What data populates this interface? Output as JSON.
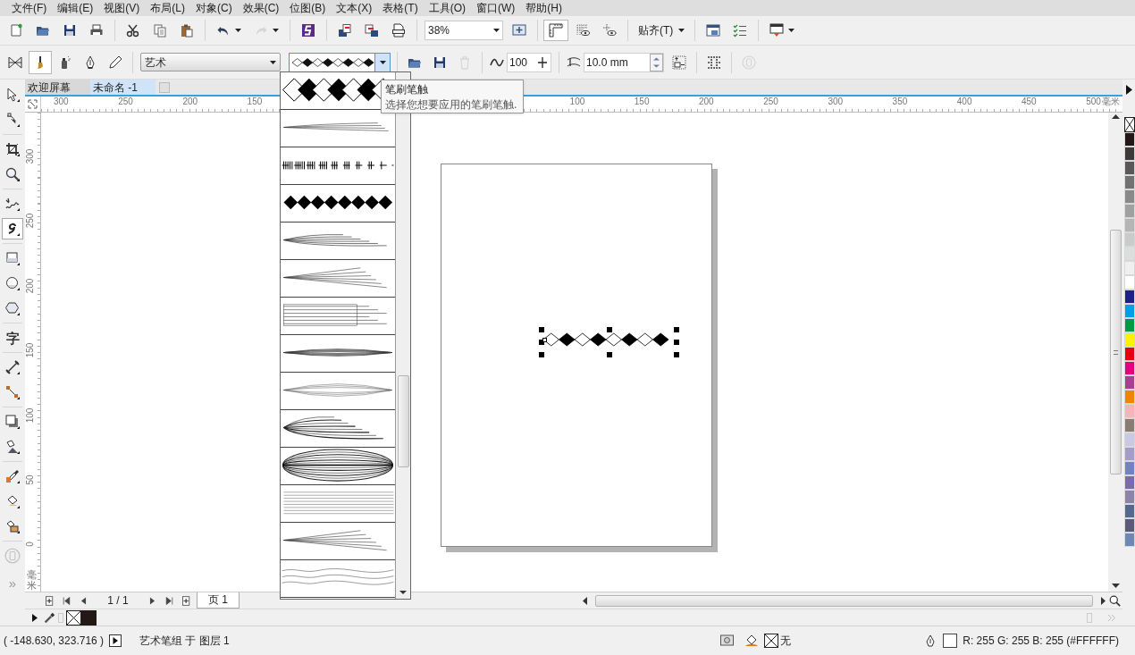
{
  "menu": [
    "文件(F)",
    "编辑(E)",
    "视图(V)",
    "布局(L)",
    "对象(C)",
    "效果(C)",
    "位图(B)",
    "文本(X)",
    "表格(T)",
    "工具(O)",
    "窗口(W)",
    "帮助(H)"
  ],
  "standard_toolbar": {
    "items": [
      {
        "kind": "new"
      },
      {
        "kind": "open"
      },
      {
        "kind": "save"
      },
      {
        "kind": "print"
      },
      {
        "kind": "separator"
      },
      {
        "kind": "cut"
      },
      {
        "kind": "copy"
      },
      {
        "kind": "paste"
      },
      {
        "kind": "separator"
      },
      {
        "kind": "undo",
        "caret": true
      },
      {
        "kind": "redo",
        "caret": true,
        "disabled": true
      },
      {
        "kind": "separator"
      },
      {
        "kind": "launcher"
      },
      {
        "kind": "separator"
      },
      {
        "kind": "import"
      },
      {
        "kind": "export"
      },
      {
        "kind": "pdf"
      },
      {
        "kind": "separator"
      },
      {
        "kind": "zoom-combo",
        "value": "38%"
      },
      {
        "kind": "fit"
      },
      {
        "kind": "separator"
      },
      {
        "kind": "rulers",
        "selected": true
      },
      {
        "kind": "grid",
        "selected": false
      },
      {
        "kind": "guidelines",
        "selected": false
      },
      {
        "kind": "separator"
      },
      {
        "kind": "text-menu",
        "label": "贴齐(T)"
      },
      {
        "kind": "separator"
      },
      {
        "kind": "options"
      },
      {
        "kind": "checklist"
      },
      {
        "kind": "separator"
      },
      {
        "kind": "welcome",
        "caret": true
      }
    ]
  },
  "property_bar": {
    "items": [
      {
        "kind": "preset-mode",
        "selected": false
      },
      {
        "kind": "brush-mode",
        "selected": true
      },
      {
        "kind": "sprayer-mode",
        "selected": false
      },
      {
        "kind": "calligraphic-mode",
        "selected": false
      },
      {
        "kind": "pressure-mode",
        "selected": false
      },
      {
        "kind": "separator"
      },
      {
        "kind": "category-combo",
        "value": "艺术"
      },
      {
        "kind": "stroke-picker",
        "open": true
      },
      {
        "kind": "separator"
      },
      {
        "kind": "browse"
      },
      {
        "kind": "save-stroke"
      },
      {
        "kind": "delete",
        "disabled": true
      },
      {
        "kind": "separator"
      },
      {
        "kind": "smoothing-field",
        "value": "100"
      },
      {
        "kind": "separator"
      },
      {
        "kind": "width-field",
        "value": "10.0 mm"
      },
      {
        "kind": "scale"
      },
      {
        "kind": "separator"
      },
      {
        "kind": "dots"
      },
      {
        "kind": "separator"
      },
      {
        "kind": "lock",
        "disabled": true
      }
    ]
  },
  "toolbox": {
    "tools": [
      {
        "kind": "pick",
        "selected": false
      },
      {
        "kind": "shape",
        "selected": false
      },
      {
        "kind": "crop",
        "selected": false
      },
      {
        "kind": "zoom",
        "selected": false
      },
      {
        "kind": "freehand",
        "selected": false
      },
      {
        "kind": "artistic",
        "selected": true
      },
      {
        "kind": "rectangle",
        "selected": false
      },
      {
        "kind": "ellipse",
        "selected": false
      },
      {
        "kind": "polygon",
        "selected": false
      },
      {
        "kind": "text",
        "glyph": "字",
        "selected": false
      },
      {
        "kind": "dimension",
        "selected": false
      },
      {
        "kind": "connector",
        "selected": false
      },
      {
        "kind": "shadow",
        "selected": false
      },
      {
        "kind": "transparency",
        "selected": false
      },
      {
        "kind": "eyedropper",
        "selected": false
      },
      {
        "kind": "fill",
        "selected": false
      },
      {
        "kind": "smart-fill",
        "selected": false
      },
      {
        "kind": "lock",
        "selected": false
      }
    ],
    "more": "»"
  },
  "document_tabs": [
    {
      "label": "欢迎屏幕",
      "selected": false
    },
    {
      "label": "未命名 -1",
      "selected": true
    }
  ],
  "horizontal_ruler": {
    "labels": [
      "300",
      "250",
      "200",
      "150",
      "100",
      "150",
      "200",
      "250",
      "300",
      "350",
      "400",
      "450",
      "500"
    ],
    "unit": "毫米"
  },
  "vertical_ruler": {
    "labels": [
      "300",
      "250",
      "200",
      "150",
      "100",
      "50",
      "0"
    ],
    "unit": "毫米"
  },
  "stroke_list": {
    "items": [
      {
        "kind": "diamond-chain"
      },
      {
        "kind": "taper-lines"
      },
      {
        "kind": "ticks"
      },
      {
        "kind": "solid-diamonds"
      },
      {
        "kind": "taper-bundle"
      },
      {
        "kind": "fan"
      },
      {
        "kind": "boxed-lines"
      },
      {
        "kind": "lens"
      },
      {
        "kind": "thin-lens"
      },
      {
        "kind": "curved-bundle"
      },
      {
        "kind": "ellipse-bundle"
      },
      {
        "kind": "parallel"
      },
      {
        "kind": "fan"
      },
      {
        "kind": "wavy"
      }
    ]
  },
  "tooltip": {
    "title": "笔刷笔触",
    "text": "选择您想要应用的笔刷笔触."
  },
  "page_navigator": {
    "page": "1 / 1",
    "tabs": [
      {
        "label": "页 1",
        "selected": true
      }
    ]
  },
  "palette": {
    "colors": [
      {
        "kind": "none"
      },
      {
        "color": "#231815"
      },
      {
        "color": "#3e3a39"
      },
      {
        "color": "#595757"
      },
      {
        "color": "#727171"
      },
      {
        "color": "#898989"
      },
      {
        "color": "#9fa0a0"
      },
      {
        "color": "#b5b5b6"
      },
      {
        "color": "#c9caca"
      },
      {
        "color": "#dcdddd"
      },
      {
        "color": "#efefef"
      },
      {
        "color": "#ffffff"
      },
      {
        "color": "#1d2088"
      },
      {
        "color": "#00a0e9"
      },
      {
        "color": "#009944"
      },
      {
        "color": "#fff100"
      },
      {
        "color": "#e60012"
      },
      {
        "color": "#e4007f"
      },
      {
        "color": "#a7408e"
      },
      {
        "color": "#f08300"
      },
      {
        "color": "#f6b3b8"
      },
      {
        "color": "#8c7b72"
      },
      {
        "color": "#cac8e3"
      },
      {
        "color": "#a59cc9"
      },
      {
        "color": "#7383c1"
      },
      {
        "color": "#7b6bae"
      },
      {
        "color": "#8d84aa"
      },
      {
        "color": "#56688f"
      },
      {
        "color": "#595a7a"
      },
      {
        "color": "#6c88b3"
      }
    ]
  },
  "document_palette": {
    "colors": [
      {
        "kind": "none"
      },
      {
        "color": "#231815"
      }
    ]
  },
  "status_bar": {
    "coordinates": "( -148.630, 323.716 )",
    "selection": "艺术笔组 于 图层 1",
    "fill": "无",
    "outline_color": "R: 255 G: 255 B: 255 (#FFFFFF)"
  }
}
